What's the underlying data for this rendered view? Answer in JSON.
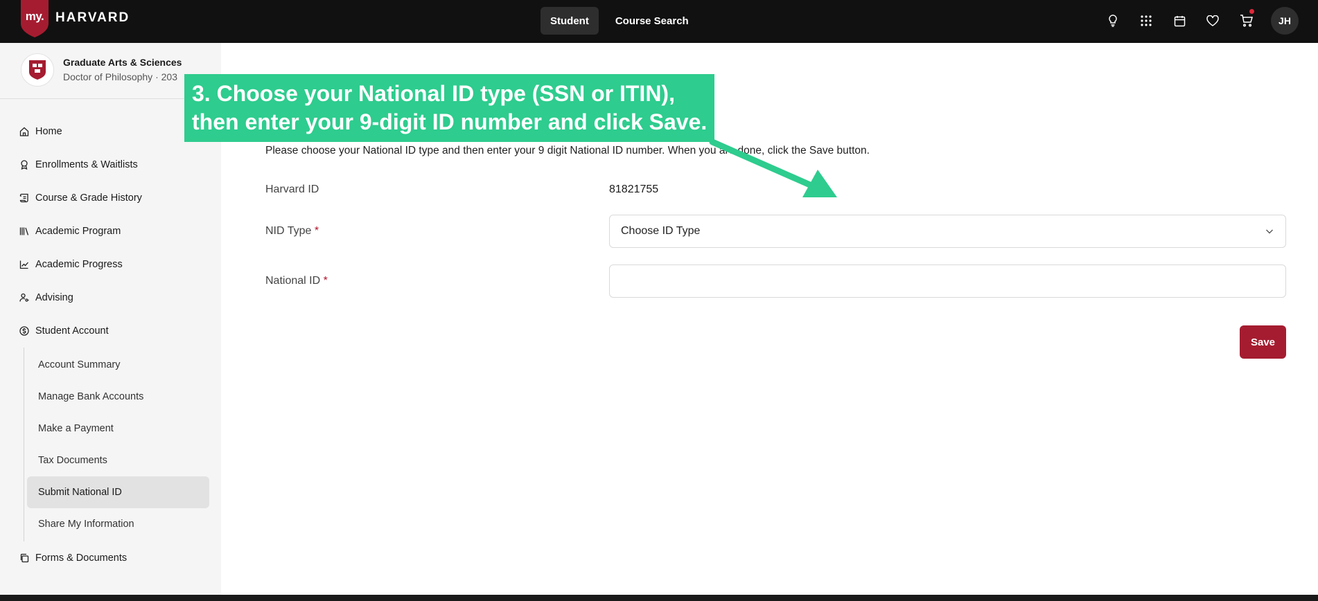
{
  "header": {
    "logo_prefix": "my.",
    "logo_word": "HARVARD",
    "tabs": [
      {
        "label": "Student",
        "active": true
      },
      {
        "label": "Course Search",
        "active": false
      }
    ],
    "icons": [
      "lightbulb-icon",
      "apps-grid-icon",
      "calendar-icon",
      "heart-icon",
      "cart-icon"
    ],
    "avatar_initials": "JH",
    "colors": {
      "bar": "#111111",
      "brand": "#a51c30",
      "notification": "#e0283a"
    }
  },
  "sidebar": {
    "program": {
      "school": "Graduate Arts & Sciences",
      "degree": "Doctor of Philosophy · 203"
    },
    "items": [
      {
        "label": "Home",
        "icon": "home-icon"
      },
      {
        "label": "Enrollments & Waitlists",
        "icon": "award-icon"
      },
      {
        "label": "Course & Grade History",
        "icon": "scroll-icon"
      },
      {
        "label": "Academic Program",
        "icon": "books-icon"
      },
      {
        "label": "Academic Progress",
        "icon": "line-chart-icon"
      },
      {
        "label": "Advising",
        "icon": "user-key-icon"
      },
      {
        "label": "Student Account",
        "icon": "dollar-circle-icon"
      }
    ],
    "student_account_subitems": [
      {
        "label": "Account Summary",
        "active": false
      },
      {
        "label": "Manage Bank Accounts",
        "active": false
      },
      {
        "label": "Make a Payment",
        "active": false
      },
      {
        "label": "Tax Documents",
        "active": false
      },
      {
        "label": "Submit National ID",
        "active": true
      },
      {
        "label": "Share My Information",
        "active": false
      }
    ],
    "after_items": [
      {
        "label": "Forms & Documents",
        "icon": "copy-icon"
      }
    ]
  },
  "main": {
    "instructions": "Please choose your National ID type and then enter your 9 digit National ID number. When you are done, click the Save button.",
    "harvard_id_label": "Harvard ID",
    "harvard_id_value": "81821755",
    "nid_type_label": "NID Type",
    "required_mark": "*",
    "nid_type_selected": "Choose ID Type",
    "national_id_label": "National ID",
    "national_id_value": "",
    "save_label": "Save"
  },
  "callout": {
    "line1": "3. Choose your National ID type (SSN or ITIN),",
    "line2": "then enter your 9-digit ID number and click Save.",
    "color": "#2ecc8e"
  }
}
